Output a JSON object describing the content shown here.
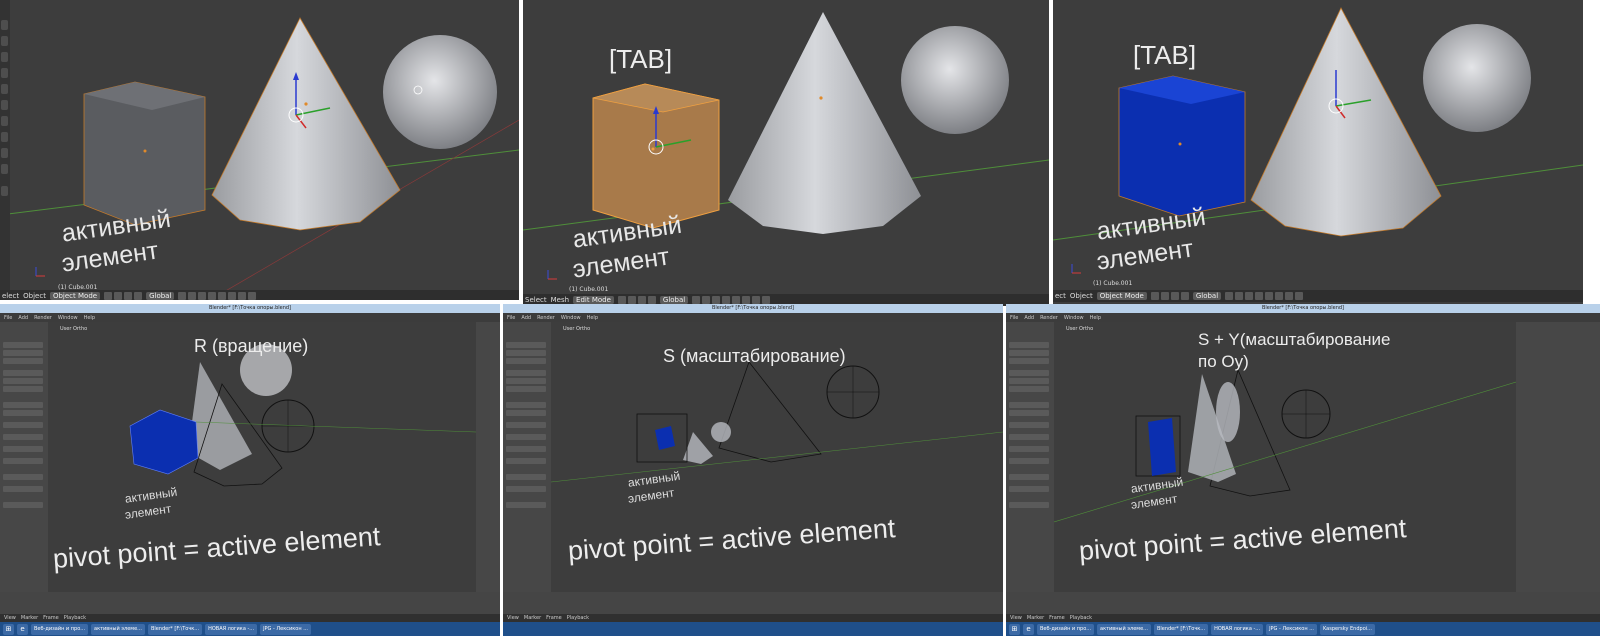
{
  "top": [
    {
      "tab_label": "",
      "active_line1": "активный",
      "active_line2": "элемент",
      "object_name": "(1) Cube.001",
      "header": {
        "menu1": "elect",
        "menu2": "Object",
        "mode": "Object Mode",
        "orientation": "Global"
      }
    },
    {
      "tab_label": "[TAB]",
      "active_line1": "активный",
      "active_line2": "элемент",
      "object_name": "(1) Cube.001",
      "header": {
        "menu1": "Select",
        "menu2": "Mesh",
        "mode": "Edit Mode",
        "orientation": "Global"
      }
    },
    {
      "tab_label": "[TAB]",
      "active_line1": "активный",
      "active_line2": "элемент",
      "object_name": "(1) Cube.001",
      "header": {
        "menu1": "ect",
        "menu2": "Object",
        "mode": "Object Mode",
        "orientation": "Global"
      }
    }
  ],
  "bottom": [
    {
      "title": "Blender* [F:\\Точка опоры.blend]",
      "menu": [
        "File",
        "Add",
        "Render",
        "Window",
        "Help"
      ],
      "view_label": "User Ortho",
      "operation": "R (вращение)",
      "operation_line2": "",
      "active_line1": "активный",
      "active_line2": "элемент",
      "pivot": "pivot point = active element",
      "timeline": [
        "View",
        "Marker",
        "Frame",
        "Playback"
      ],
      "taskbar": [
        "Веб-дизайн и про...",
        "активный элеме...",
        "Blender* [F:\\Точк...",
        "НОВАЯ логика -...",
        "JPG - Лексикон ...",
        "Kaspersky Endpoi..."
      ]
    },
    {
      "title": "Blender* [F:\\Точка опоры.blend]",
      "menu": [
        "File",
        "Add",
        "Render",
        "Window",
        "Help"
      ],
      "view_label": "User Ortho",
      "operation": "S (масштабирование)",
      "operation_line2": "",
      "active_line1": "активный",
      "active_line2": "элемент",
      "pivot": "pivot point = active element",
      "timeline": [
        "View",
        "Marker",
        "Frame",
        "Playback"
      ],
      "taskbar": []
    },
    {
      "title": "Blender* [F:\\Точка опоры.blend]",
      "menu": [
        "File",
        "Add",
        "Render",
        "Window",
        "Help"
      ],
      "view_label": "User Ortho",
      "operation": "S + Y(масштабирование",
      "operation_line2": "по Oy)",
      "active_line1": "активный",
      "active_line2": "элемент",
      "pivot": "pivot point = active element",
      "timeline": [
        "View",
        "Marker",
        "Frame",
        "Playback"
      ],
      "taskbar": [
        "Веб-дизайн и про...",
        "активный элеме...",
        "Blender* [F:\\Точк...",
        "НОВАЯ логика -...",
        "JPG - Лексикон ...",
        "Kaspersky Endpoi..."
      ]
    }
  ],
  "colors": {
    "viewport_bg": "#3d3d3d",
    "selected_cube_orange": "#a87a4a",
    "active_blue": "#0b2fb0",
    "grid_green": "#4f8f3a",
    "grid_red": "#8a3a3a"
  },
  "icons": [
    "tool-shelf-icon",
    "viewport-shading-icon",
    "pivot-icon",
    "manipulator-icon",
    "layers-icon",
    "windows-start-icon"
  ]
}
